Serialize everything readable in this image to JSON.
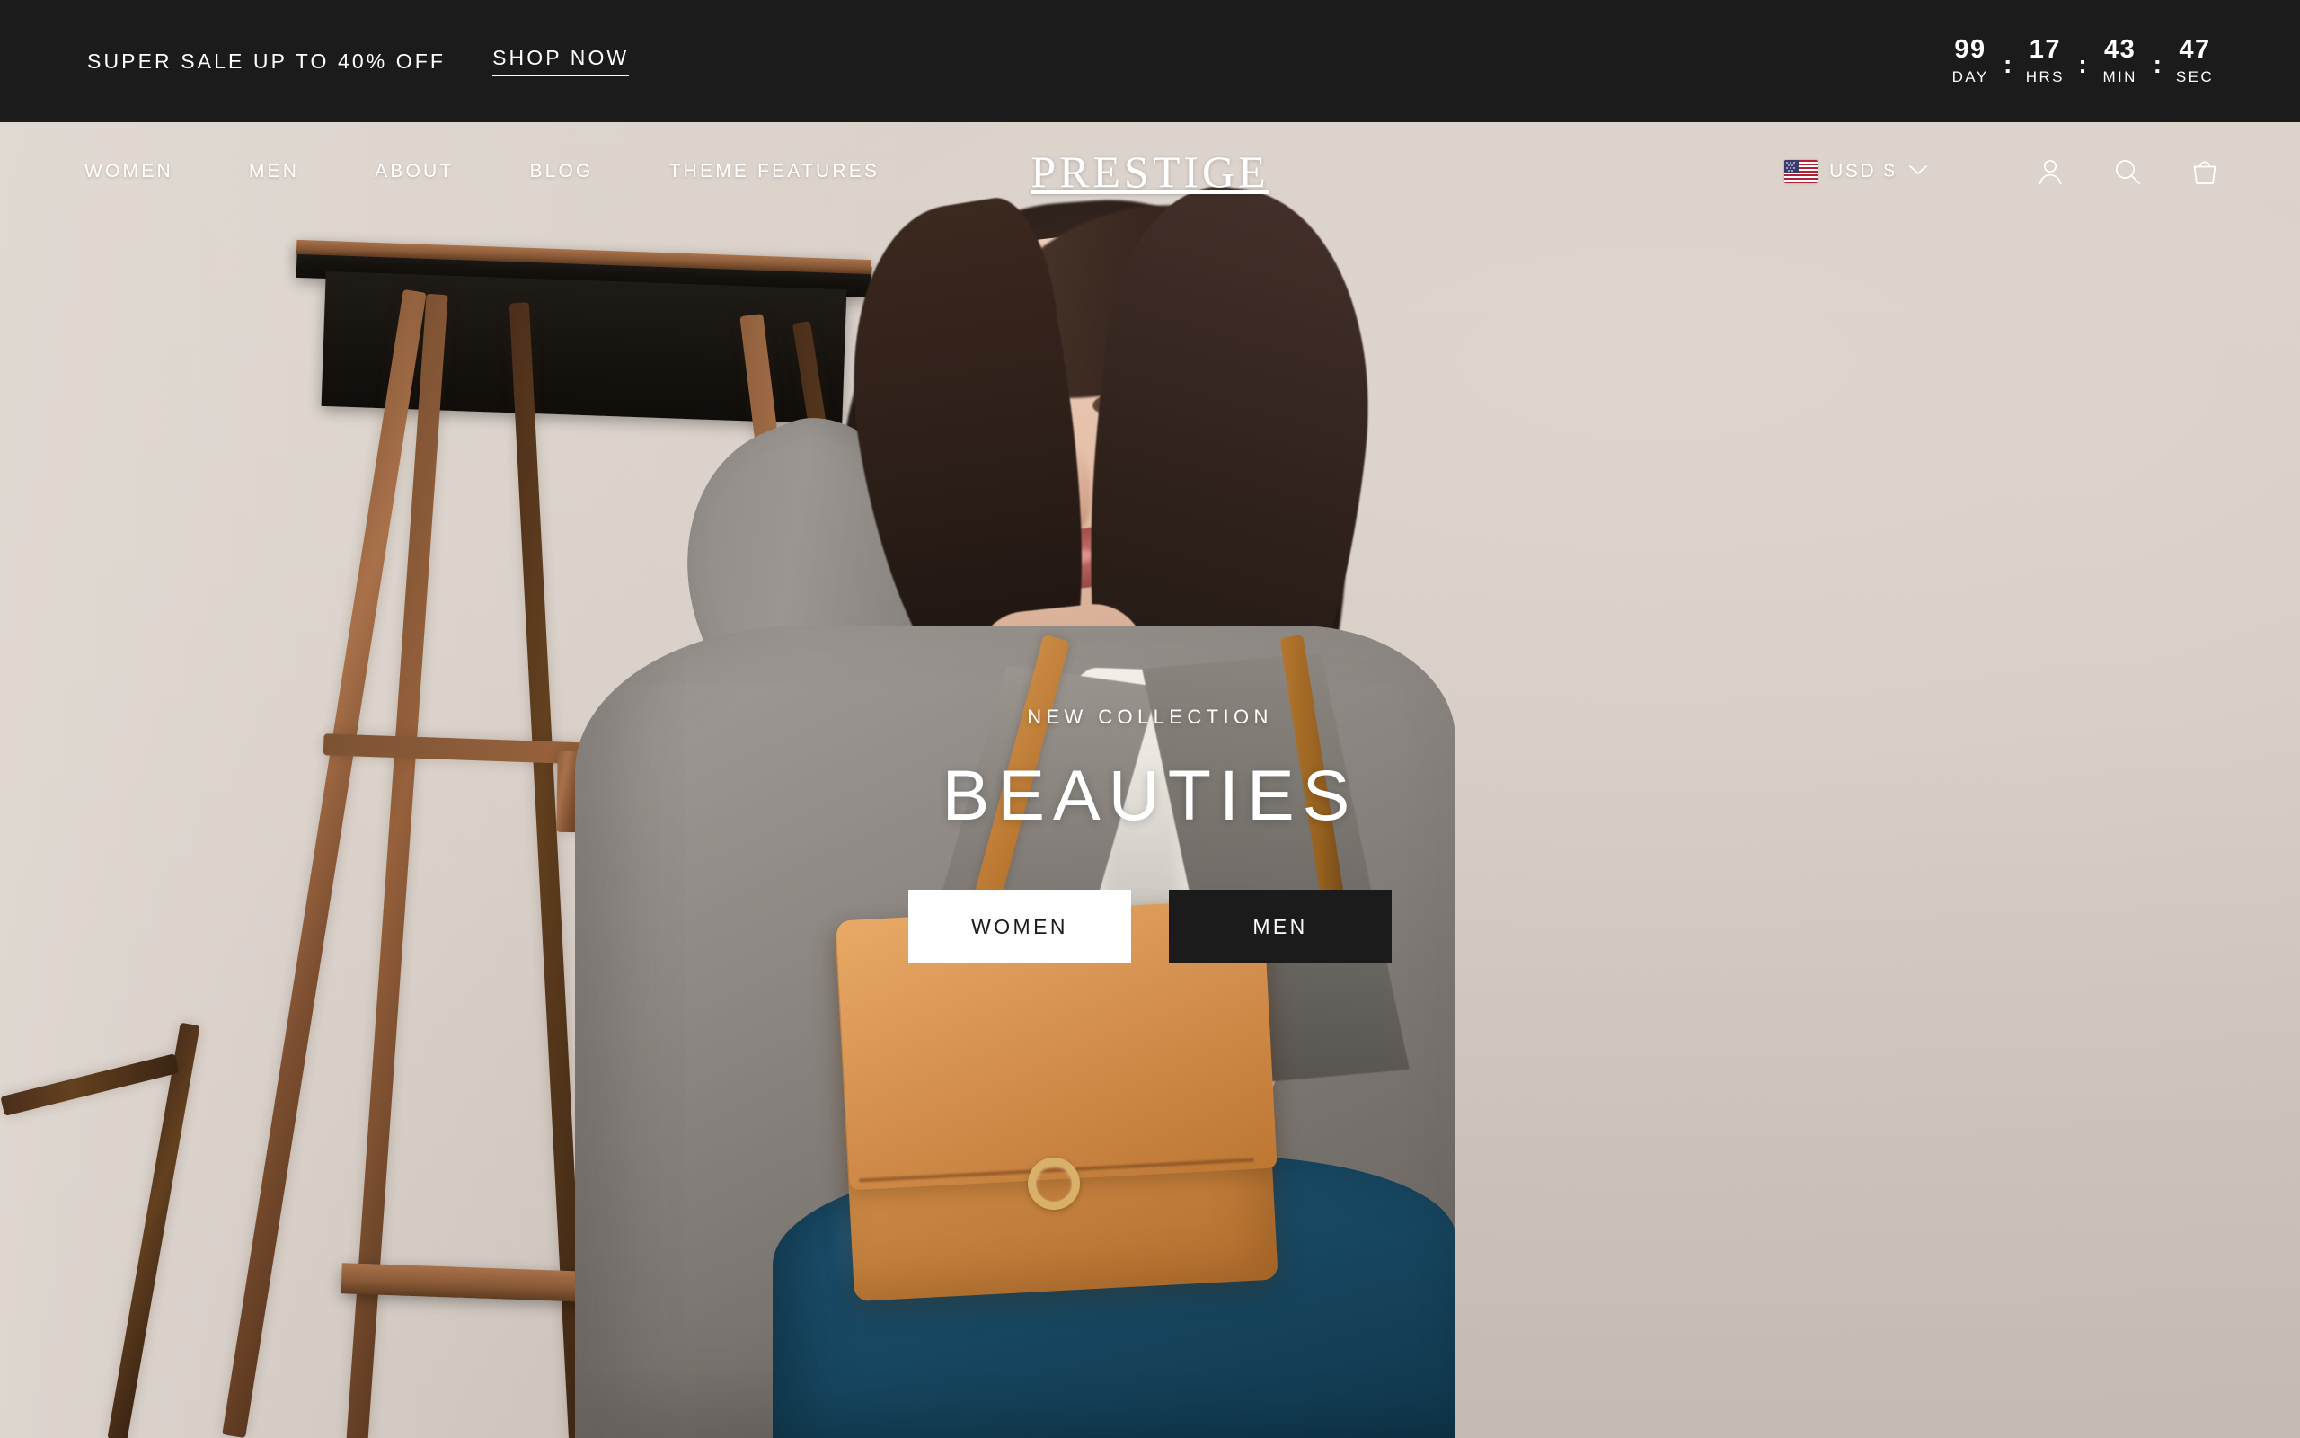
{
  "announcement": {
    "text": "SUPER SALE UP TO 40% OFF",
    "cta_label": "SHOP NOW",
    "countdown": {
      "separator": ":",
      "units": [
        {
          "value": "99",
          "label": "DAY"
        },
        {
          "value": "17",
          "label": "HRS"
        },
        {
          "value": "43",
          "label": "MIN"
        },
        {
          "value": "47",
          "label": "SEC"
        }
      ]
    }
  },
  "header": {
    "logo": "PRESTIGE",
    "nav": [
      {
        "label": "WOMEN"
      },
      {
        "label": "MEN"
      },
      {
        "label": "ABOUT"
      },
      {
        "label": "BLOG"
      },
      {
        "label": "THEME FEATURES"
      }
    ],
    "currency": {
      "flag": "us-flag-icon",
      "label": "USD $",
      "chevron": "chevron-down-icon"
    },
    "icons": [
      {
        "name": "account-icon"
      },
      {
        "name": "search-icon"
      },
      {
        "name": "cart-icon"
      }
    ]
  },
  "hero": {
    "eyebrow": "NEW COLLECTION",
    "headline": "BEAUTIES",
    "buttons": [
      {
        "label": "WOMEN",
        "style": "light"
      },
      {
        "label": "MEN",
        "style": "dark"
      }
    ]
  },
  "colors": {
    "announcement_bg": "#1b1b1b",
    "text_light": "#ffffff",
    "hero_backdrop": "#d6cdc5",
    "button_dark": "#1b1b1b",
    "button_light": "#ffffff",
    "bag_leather": "#cf8c49",
    "jeans_denim": "#184862",
    "blazer_grey": "#8e8984",
    "ladder_wood": "#8a5a37"
  }
}
